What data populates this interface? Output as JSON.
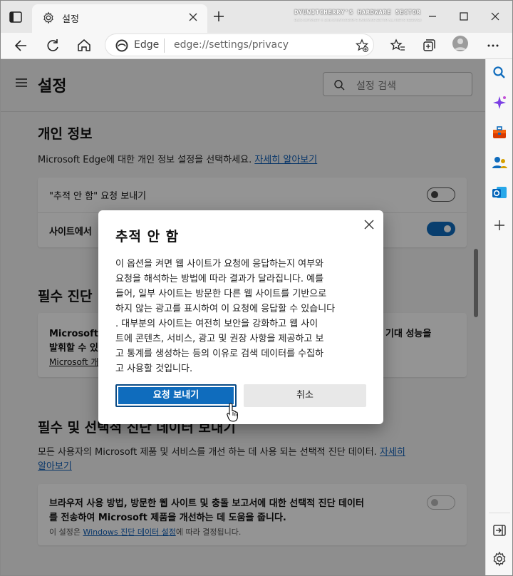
{
  "browser": {
    "tab_title": "설정",
    "watermark": "DYUWITCHERRY'S HARDWARE SECTOR",
    "watermark_sub": "BLOG COPYRIGHT © 2016 DYUWITCHERRY'S HARDWARE SECTOR ALL RIGHTS RESERVED",
    "address_brand": "Edge",
    "address_url": "edge://settings/privacy"
  },
  "settings": {
    "title": "설정",
    "search_placeholder": "설정 검색",
    "privacy": {
      "heading": "개인 정보",
      "desc": "Microsoft Edge에 대한 개인 정보 설정을 선택하세요. ",
      "learn_more": "자세히 알아보기",
      "row1": "\"추적 안 함\" 요청 보내기",
      "row2": "사이트에서"
    },
    "required": {
      "heading": "필수 진단",
      "line1": "Microsoft는",
      "line1_tail": "기대 성능을",
      "line2": "발휘할 수 있",
      "link": "Microsoft 개"
    },
    "optional": {
      "heading": "필수 및 선택적 진단 데이터 보내기",
      "desc": "모든 사용자의 Microsoft 제품 및 서비스를 개선 하는 데 사용 되는 선택적 진단 데이터. ",
      "learn_more_1": "자세히",
      "learn_more_2": "알아보기",
      "card_line1": "브라우저 사용 방법, 방문한 웹 사이트 및 충돌 보고서에 대한 선택적 진단 데이터",
      "card_line2": "를 전송하여 Microsoft 제품을 개선하는 데 도움을 줍니다.",
      "note_prefix": "이 설정은 ",
      "note_link": "Windows 진단 데이터 설정",
      "note_suffix": "에 따라 결정됩니다."
    }
  },
  "dialog": {
    "title": "추적 안 함",
    "body_lines": [
      "이 옵션을 켜면 웹 사이트가 요청에 응답하는지 여부와",
      "요청을 해석하는 방법에 따라 결과가 달라집니다. 예를",
      "들어, 일부 사이트는 방문한 다른 웹 사이트를 기반으로",
      "하지 않는 광고를 표시하여 이 요청에 응답할 수 있습니다",
      ". 대부분의 사이트는 여전히 보안을 강화하고 웹 사이",
      "트에 콘텐츠, 서비스, 광고 및 권장 사항을 제공하고 보",
      "고 통계를 생성하는 등의 이유로 검색 데이터를 수집하",
      "고 사용할 것입니다."
    ],
    "primary_button": "요청 보내기",
    "secondary_button": "취소"
  },
  "colors": {
    "accent": "#0f6cbd",
    "link": "#0f5db5"
  }
}
